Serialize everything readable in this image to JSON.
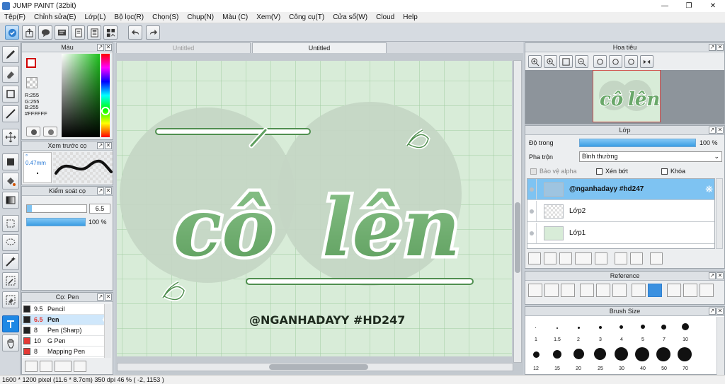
{
  "window": {
    "title": "JUMP PAINT (32bit)"
  },
  "menu": [
    "Tệp(F)",
    "Chỉnh sửa(E)",
    "Lớp(L)",
    "Bộ lọc(R)",
    "Chọn(S)",
    "Chụp(N)",
    "Màu (C)",
    "Xem(V)",
    "Công cụ(T)",
    "Cửa sổ(W)",
    "Cloud",
    "Help"
  ],
  "tabs": {
    "tab1": "Untitled",
    "tab2": "Untitled"
  },
  "color_panel": {
    "title": "Màu",
    "r": "R:255",
    "g": "G:255",
    "b": "B:255",
    "hex": "#FFFFFF"
  },
  "brush_preview": {
    "title": "Xem trước cọ",
    "size": "° 0.47mm"
  },
  "brush_control": {
    "title": "Kiểm soát cọ",
    "size_value": "6.5",
    "opacity_value": "100 %"
  },
  "brush_list": {
    "title": "Cọ: Pen",
    "items": [
      {
        "size": "9.5",
        "name": "Pencil",
        "swatch": "#222222"
      },
      {
        "size": "6.5",
        "name": "Pen",
        "swatch": "#222222"
      },
      {
        "size": "8",
        "name": "Pen (Sharp)",
        "swatch": "#222222"
      },
      {
        "size": "10",
        "name": "G Pen",
        "swatch": "#e53935"
      },
      {
        "size": "8",
        "name": "Mapping Pen",
        "swatch": "#e53935"
      }
    ]
  },
  "navigator": {
    "title": "Hoa tiêu"
  },
  "layers": {
    "title": "Lớp",
    "opacity_label": "Độ trong",
    "opacity_value": "100 %",
    "blend_label": "Pha trộn",
    "blend_value": "Bình thường",
    "protect_alpha": "Bảo vệ alpha",
    "clip": "Xén bớt",
    "lock": "Khóa",
    "items": [
      {
        "name": "@nganhadayy #hd247"
      },
      {
        "name": "Lớp2"
      },
      {
        "name": "Lớp1"
      }
    ]
  },
  "reference": {
    "title": "Reference"
  },
  "brush_size": {
    "title": "Brush Size",
    "row1": [
      "1",
      "1.5",
      "2",
      "3",
      "4",
      "5",
      "7",
      "10"
    ],
    "row2": [
      "12",
      "15",
      "20",
      "25",
      "30",
      "40",
      "50",
      "70"
    ]
  },
  "artwork": {
    "word1": "cô",
    "word2": "lên",
    "watermark": "@NGANHADAYY #HD247"
  },
  "status": {
    "text": "1600 * 1200 pixel   (11.6 * 8.7cm)   350 dpi   46 %   ( -2, 1153 )"
  },
  "colors": {
    "accent": "#1e88e5",
    "selection": "#7ec3f2",
    "canvas_bg": "#d8ecd8",
    "letter": "#6aa86a"
  }
}
